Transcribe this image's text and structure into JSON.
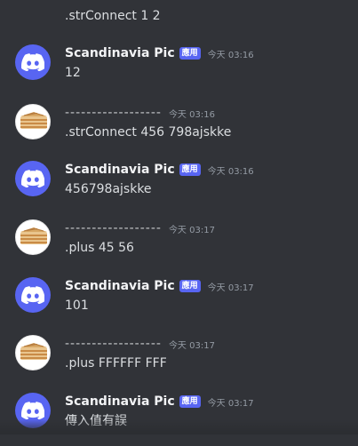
{
  "chat": {
    "top_partial_text": ".strConnect 1 2",
    "messages": [
      {
        "kind": "bot",
        "username": "Scandinavia Pic",
        "badge": "應用",
        "timestamp": "今天 03:16",
        "content": "12"
      },
      {
        "kind": "user",
        "username": "------------------",
        "timestamp": "今天 03:16",
        "content": ".strConnect 456 798ajskke"
      },
      {
        "kind": "bot",
        "username": "Scandinavia Pic",
        "badge": "應用",
        "timestamp": "今天 03:16",
        "content": "456798ajskke"
      },
      {
        "kind": "user",
        "username": "------------------",
        "timestamp": "今天 03:17",
        "content": ".plus 45 56"
      },
      {
        "kind": "bot",
        "username": "Scandinavia Pic",
        "badge": "應用",
        "timestamp": "今天 03:17",
        "content": "101"
      },
      {
        "kind": "user",
        "username": "------------------",
        "timestamp": "今天 03:17",
        "content": ".plus FFFFFF FFF"
      },
      {
        "kind": "bot",
        "username": "Scandinavia Pic",
        "badge": "應用",
        "timestamp": "今天 03:17",
        "content": "傳入值有誤"
      }
    ]
  },
  "colors": {
    "background": "#313338",
    "bot_avatar": "#5865f2",
    "app_badge": "#5865f2",
    "timestamp": "#949ba4",
    "text": "#dbdee1"
  },
  "icons": {
    "bot_avatar": "discord-logo-icon",
    "user_avatar": "wafer-cake-icon"
  }
}
